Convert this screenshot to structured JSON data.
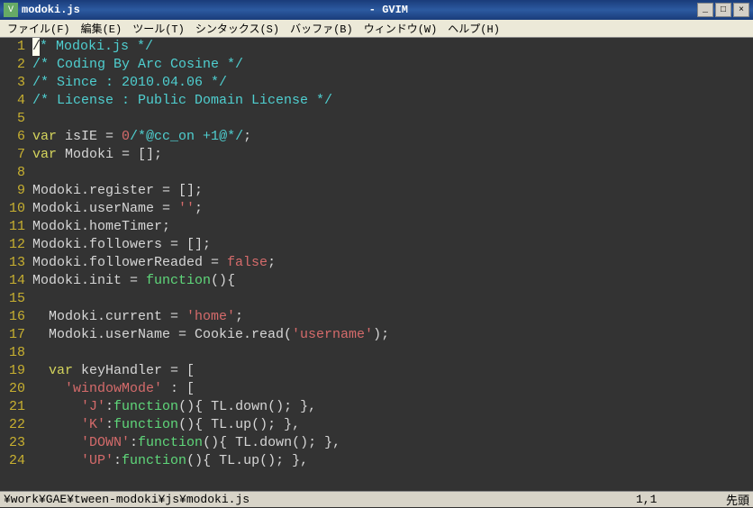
{
  "titlebar": {
    "filename": "modoki.js",
    "app_title": "- GVIM"
  },
  "window_controls": {
    "minimize": "_",
    "maximize": "□",
    "close": "×"
  },
  "menubar": {
    "file": "ファイル(F)",
    "edit": "編集(E)",
    "tools": "ツール(T)",
    "syntax": "シンタックス(S)",
    "buffers": "バッファ(B)",
    "window": "ウィンドウ(W)",
    "help": "ヘルプ(H)"
  },
  "statusbar": {
    "path": "¥work¥GAE¥tween-modoki¥js¥modoki.js",
    "position": "1,1",
    "mode": "先頭"
  },
  "code_lines": [
    {
      "n": "1",
      "tokens": [
        {
          "c": "cursor",
          "t": "/"
        },
        {
          "c": "cmt",
          "t": "* Modoki.js */"
        }
      ]
    },
    {
      "n": "2",
      "tokens": [
        {
          "c": "cmt",
          "t": "/* Coding By Arc Cosine */"
        }
      ]
    },
    {
      "n": "3",
      "tokens": [
        {
          "c": "cmt",
          "t": "/* Since : 2010.04.06 */"
        }
      ]
    },
    {
      "n": "4",
      "tokens": [
        {
          "c": "cmt",
          "t": "/* License : Public Domain License */"
        }
      ]
    },
    {
      "n": "5",
      "tokens": []
    },
    {
      "n": "6",
      "tokens": [
        {
          "c": "key",
          "t": "var "
        },
        {
          "c": "ident",
          "t": "isIE = "
        },
        {
          "c": "num",
          "t": "0"
        },
        {
          "c": "cmt",
          "t": "/*@cc_on +1@*/"
        },
        {
          "c": "ident",
          "t": ";"
        }
      ]
    },
    {
      "n": "7",
      "tokens": [
        {
          "c": "key",
          "t": "var "
        },
        {
          "c": "ident",
          "t": "Modoki = [];"
        }
      ]
    },
    {
      "n": "8",
      "tokens": []
    },
    {
      "n": "9",
      "tokens": [
        {
          "c": "ident",
          "t": "Modoki.register = [];"
        }
      ]
    },
    {
      "n": "10",
      "tokens": [
        {
          "c": "ident",
          "t": "Modoki.userName = "
        },
        {
          "c": "str",
          "t": "''"
        },
        {
          "c": "ident",
          "t": ";"
        }
      ]
    },
    {
      "n": "11",
      "tokens": [
        {
          "c": "ident",
          "t": "Modoki.homeTimer;"
        }
      ]
    },
    {
      "n": "12",
      "tokens": [
        {
          "c": "ident",
          "t": "Modoki.followers = [];"
        }
      ]
    },
    {
      "n": "13",
      "tokens": [
        {
          "c": "ident",
          "t": "Modoki.followerReaded = "
        },
        {
          "c": "bool",
          "t": "false"
        },
        {
          "c": "ident",
          "t": ";"
        }
      ]
    },
    {
      "n": "14",
      "tokens": [
        {
          "c": "ident",
          "t": "Modoki.init = "
        },
        {
          "c": "func",
          "t": "function"
        },
        {
          "c": "paren",
          "t": "()"
        },
        {
          "c": "ident",
          "t": "{"
        }
      ]
    },
    {
      "n": "15",
      "tokens": []
    },
    {
      "n": "16",
      "tokens": [
        {
          "c": "ident",
          "t": "  Modoki.current = "
        },
        {
          "c": "str",
          "t": "'home'"
        },
        {
          "c": "ident",
          "t": ";"
        }
      ]
    },
    {
      "n": "17",
      "tokens": [
        {
          "c": "ident",
          "t": "  Modoki.userName = Cookie.read("
        },
        {
          "c": "str",
          "t": "'username'"
        },
        {
          "c": "ident",
          "t": ");"
        }
      ]
    },
    {
      "n": "18",
      "tokens": []
    },
    {
      "n": "19",
      "tokens": [
        {
          "c": "ident",
          "t": "  "
        },
        {
          "c": "key",
          "t": "var "
        },
        {
          "c": "ident",
          "t": "keyHandler = ["
        }
      ]
    },
    {
      "n": "20",
      "tokens": [
        {
          "c": "ident",
          "t": "    "
        },
        {
          "c": "str",
          "t": "'windowMode'"
        },
        {
          "c": "ident",
          "t": " : ["
        }
      ]
    },
    {
      "n": "21",
      "tokens": [
        {
          "c": "ident",
          "t": "      "
        },
        {
          "c": "str",
          "t": "'J'"
        },
        {
          "c": "ident",
          "t": ":"
        },
        {
          "c": "func",
          "t": "function"
        },
        {
          "c": "paren",
          "t": "()"
        },
        {
          "c": "ident",
          "t": "{ TL.down(); },"
        }
      ]
    },
    {
      "n": "22",
      "tokens": [
        {
          "c": "ident",
          "t": "      "
        },
        {
          "c": "str",
          "t": "'K'"
        },
        {
          "c": "ident",
          "t": ":"
        },
        {
          "c": "func",
          "t": "function"
        },
        {
          "c": "paren",
          "t": "()"
        },
        {
          "c": "ident",
          "t": "{ TL.up(); },"
        }
      ]
    },
    {
      "n": "23",
      "tokens": [
        {
          "c": "ident",
          "t": "      "
        },
        {
          "c": "str",
          "t": "'DOWN'"
        },
        {
          "c": "ident",
          "t": ":"
        },
        {
          "c": "func",
          "t": "function"
        },
        {
          "c": "paren",
          "t": "()"
        },
        {
          "c": "ident",
          "t": "{ TL.down(); },"
        }
      ]
    },
    {
      "n": "24",
      "tokens": [
        {
          "c": "ident",
          "t": "      "
        },
        {
          "c": "str",
          "t": "'UP'"
        },
        {
          "c": "ident",
          "t": ":"
        },
        {
          "c": "func",
          "t": "function"
        },
        {
          "c": "paren",
          "t": "()"
        },
        {
          "c": "ident",
          "t": "{ TL.up(); },"
        }
      ]
    }
  ]
}
